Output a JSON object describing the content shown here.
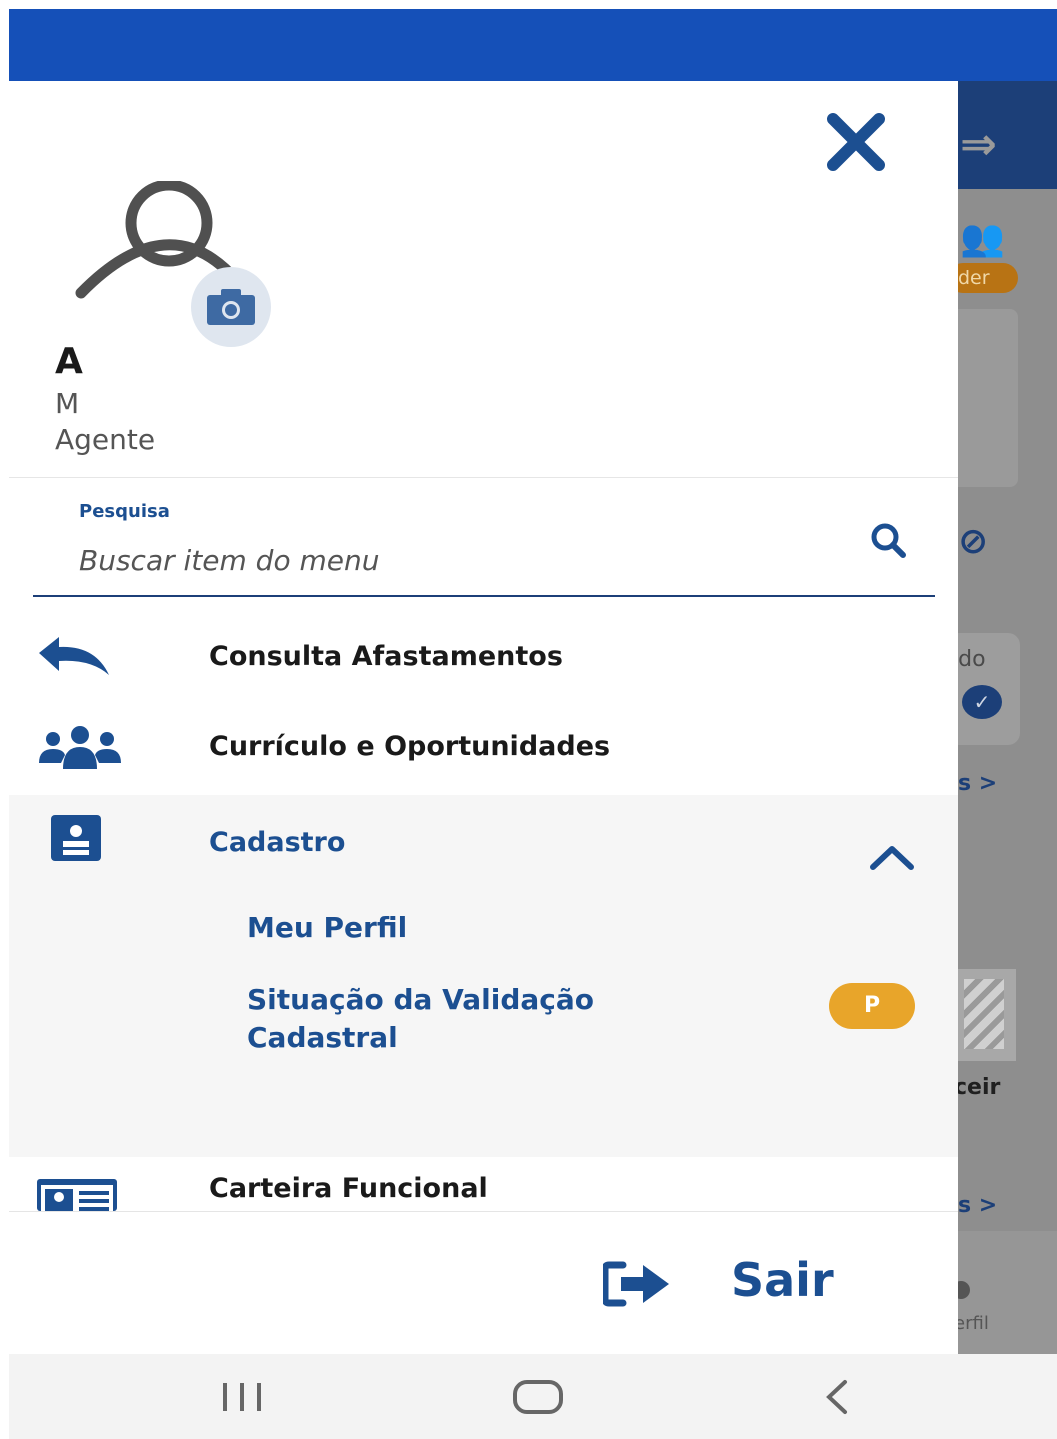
{
  "colors": {
    "primary": "#1c4f91",
    "topbar": "#1550b8",
    "badge": "#e8a52a"
  },
  "profile": {
    "initial": "A",
    "line2": "M",
    "role": "Agente"
  },
  "search": {
    "label": "Pesquisa",
    "placeholder": "Buscar item do menu"
  },
  "menu": {
    "items": [
      {
        "label": "Consulta Afastamentos",
        "icon": "reply-arrow-icon"
      },
      {
        "label": "Currículo e Oportunidades",
        "icon": "users-icon"
      },
      {
        "label": "Cadastro",
        "icon": "id-badge-icon",
        "expanded": true,
        "children": [
          {
            "label": "Meu Perfil"
          },
          {
            "label": "Situação da Validação Cadastral",
            "badge": "P"
          }
        ]
      },
      {
        "label": "Carteira Funcional",
        "icon": "id-card-icon"
      }
    ]
  },
  "logout": {
    "label": "Sair"
  },
  "background_app": {
    "badge_text": "der",
    "card_text": "ido",
    "link_glyph": "s >",
    "partial_text": "ceir",
    "nav_label": "erfil"
  }
}
